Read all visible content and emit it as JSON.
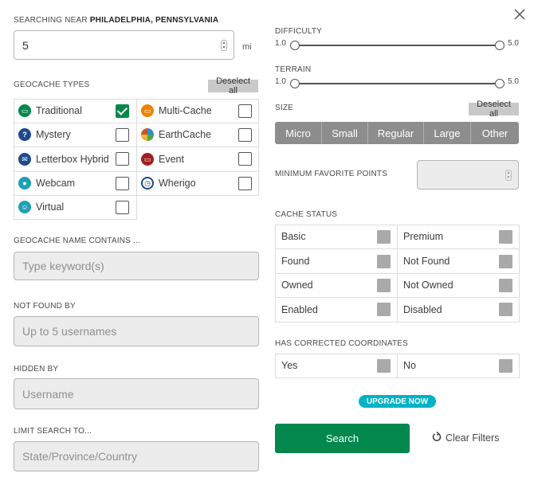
{
  "location": {
    "prefix": "SEARCHING NEAR",
    "place": "PHILADELPHIA, PENNSYLVANIA",
    "radius": "5",
    "unit": "mi"
  },
  "types": {
    "label": "GEOCACHE TYPES",
    "deselect": "Deselect all",
    "items": [
      {
        "label": "Traditional",
        "icon": "traditional-icon",
        "checked": true
      },
      {
        "label": "Multi-Cache",
        "icon": "multi-cache-icon",
        "checked": false
      },
      {
        "label": "Mystery",
        "icon": "mystery-icon",
        "checked": false
      },
      {
        "label": "EarthCache",
        "icon": "earthcache-icon",
        "checked": false
      },
      {
        "label": "Letterbox Hybrid",
        "icon": "letterbox-icon",
        "checked": false
      },
      {
        "label": "Event",
        "icon": "event-icon",
        "checked": false
      },
      {
        "label": "Webcam",
        "icon": "webcam-icon",
        "checked": false
      },
      {
        "label": "Wherigo",
        "icon": "wherigo-icon",
        "checked": false
      },
      {
        "label": "Virtual",
        "icon": "virtual-icon",
        "checked": false
      }
    ]
  },
  "name_contains": {
    "label": "GEOCACHE NAME CONTAINS ...",
    "placeholder": "Type keyword(s)"
  },
  "not_found_by": {
    "label": "NOT FOUND BY",
    "placeholder": "Up to 5 usernames"
  },
  "hidden_by": {
    "label": "HIDDEN BY",
    "placeholder": "Username"
  },
  "limit": {
    "label": "LIMIT SEARCH TO...",
    "placeholder": "State/Province/Country"
  },
  "difficulty": {
    "label": "DIFFICULTY",
    "min": "1.0",
    "max": "5.0"
  },
  "terrain": {
    "label": "TERRAIN",
    "min": "1.0",
    "max": "5.0"
  },
  "size": {
    "label": "SIZE",
    "deselect": "Deselect all",
    "options": [
      "Micro",
      "Small",
      "Regular",
      "Large",
      "Other"
    ]
  },
  "favorites": {
    "label": "MINIMUM FAVORITE POINTS",
    "value": ""
  },
  "cache_status": {
    "label": "CACHE STATUS",
    "items": [
      "Basic",
      "Premium",
      "Found",
      "Not Found",
      "Owned",
      "Not Owned",
      "Enabled",
      "Disabled"
    ]
  },
  "corrected": {
    "label": "HAS CORRECTED COORDINATES",
    "items": [
      "Yes",
      "No"
    ]
  },
  "upgrade": "UPGRADE NOW",
  "search": "Search",
  "clear": "Clear Filters",
  "colors": {
    "green": "#02874d",
    "teal": "#00b3c6",
    "gray_button": "#8d8d8d"
  }
}
